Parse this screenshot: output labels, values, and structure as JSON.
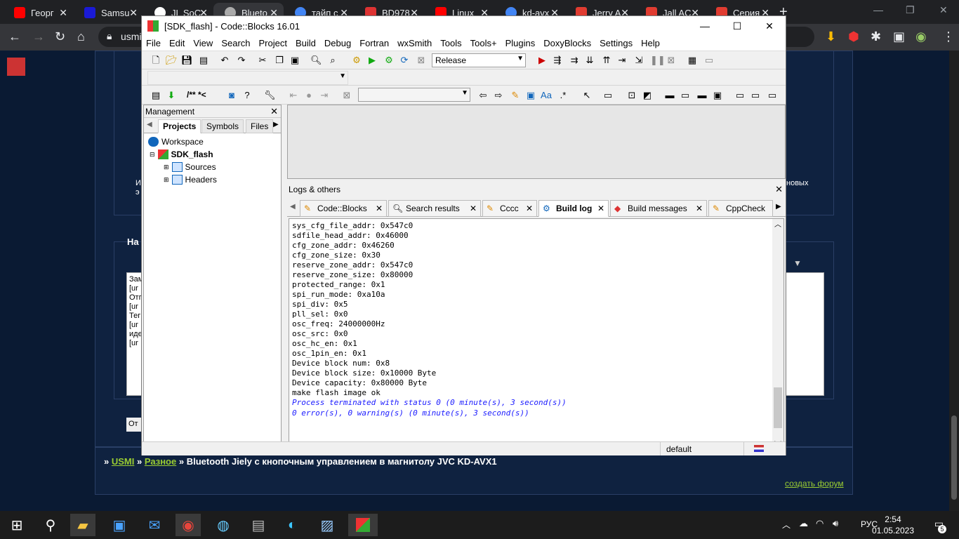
{
  "browser": {
    "tabs": [
      {
        "label": "Георг",
        "color": "#ff0000"
      },
      {
        "label": "Samsu",
        "color": "#1a1ad6"
      },
      {
        "label": "JL SoC",
        "color": "#ffffff"
      },
      {
        "label": "Blueto",
        "color": "#aaaaaa"
      },
      {
        "label": "тайп с",
        "color": "#4285f4"
      },
      {
        "label": "BD978",
        "color": "#d33"
      },
      {
        "label": "Linux",
        "color": "#ff0000"
      },
      {
        "label": "kd-avx",
        "color": "#4285f4"
      },
      {
        "label": "Jerry A",
        "color": "#e03c31"
      },
      {
        "label": "Jall AC",
        "color": "#e03c31"
      },
      {
        "label": "Серия",
        "color": "#e03c31"
      }
    ],
    "new_tab": "+",
    "address": "usmi"
  },
  "page": {
    "breadcrumb": {
      "sep": "»",
      "link1": "USMI",
      "link2": "Разное",
      "current": "Bluetooth Jiely с кнопочным управлением в магнитолу JVC KD-AVX1"
    },
    "footer_link": "создать форум",
    "left_text": [
      "И",
      "э"
    ],
    "na": "На",
    "ot": "От",
    "side_text": [
      "Зам",
      "[ur",
      "Отп",
      "[ur",
      "Тег",
      "[ur",
      "иде",
      "[ur"
    ],
    "novyh": "новых"
  },
  "codeblocks": {
    "title": "[SDK_flash] - Code::Blocks 16.01",
    "menu": [
      "File",
      "Edit",
      "View",
      "Search",
      "Project",
      "Build",
      "Debug",
      "Fortran",
      "wxSmith",
      "Tools",
      "Tools+",
      "Plugins",
      "DoxyBlocks",
      "Settings",
      "Help"
    ],
    "build_target": "Release",
    "doxy_text": "/** *<",
    "management": {
      "title": "Management",
      "tabs": [
        "Projects",
        "Symbols",
        "Files"
      ],
      "tree": {
        "workspace": "Workspace",
        "project": "SDK_flash",
        "sources": "Sources",
        "headers": "Headers"
      }
    },
    "logs": {
      "title": "Logs & others",
      "tabs": [
        "Code::Blocks",
        "Search results",
        "Cccc",
        "Build log",
        "Build messages",
        "CppCheck"
      ],
      "lines": [
        "sys_cfg_file_addr: 0x547c0",
        "sdfile_head_addr: 0x46000",
        "cfg_zone_addr: 0x46260",
        "cfg_zone_size: 0x30",
        "reserve_zone_addr: 0x547c0",
        "reserve_zone_size: 0x80000",
        "protected_range: 0x1",
        "spi_run_mode: 0xa10a",
        "spi_div: 0x5",
        "pll_sel: 0x0",
        "osc_freq: 24000000Hz",
        "osc_src: 0x0",
        "osc_hc_en: 0x1",
        "osc_1pin_en: 0x1",
        "Device block num: 0x8",
        "Device block size: 0x10000 Byte",
        "Device capacity: 0x80000 Byte",
        "make flash image ok"
      ],
      "result1": "Process terminated with status 0 (0 minute(s), 3 second(s))",
      "result2": "0 error(s), 0 warning(s) (0 minute(s), 3 second(s))"
    },
    "status": "default"
  },
  "taskbar": {
    "lang": "РУС",
    "time": "2:54",
    "date": "01.05.2023",
    "notif": "5"
  }
}
